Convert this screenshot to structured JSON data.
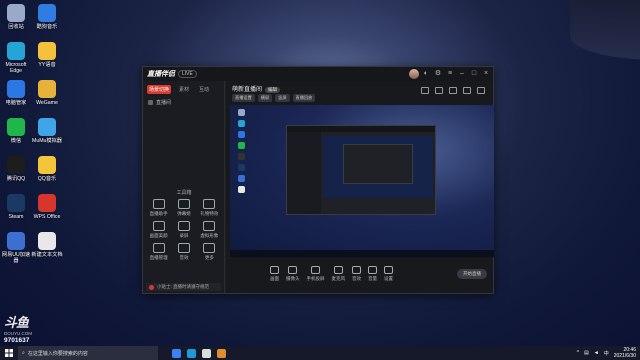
{
  "desktop_icons": [
    {
      "label": "回收站",
      "icon": "recycle-bin-icon",
      "color": "#9aa9c9"
    },
    {
      "label": "酷狗音乐",
      "icon": "kugou-icon",
      "color": "#2f7de1"
    },
    {
      "label": "Microsoft Edge",
      "icon": "edge-icon",
      "color": "#23a6d5"
    },
    {
      "label": "YY语音",
      "icon": "yy-icon",
      "color": "#f3c13a"
    },
    {
      "label": "电脑管家",
      "icon": "pc-manager-icon",
      "color": "#2b78e4"
    },
    {
      "label": "WeGame",
      "icon": "wegame-icon",
      "color": "#e7b23a"
    },
    {
      "label": "微信",
      "icon": "wechat-icon",
      "color": "#1fb74a"
    },
    {
      "label": "MuMu模拟器",
      "icon": "mumu-icon",
      "color": "#3fa4e8"
    },
    {
      "label": "腾讯QQ",
      "icon": "qq-icon",
      "color": "#1d1d1d"
    },
    {
      "label": "QQ音乐",
      "icon": "qqmusic-icon",
      "color": "#f2c53a"
    },
    {
      "label": "Steam",
      "icon": "steam-icon",
      "color": "#1b3a63"
    },
    {
      "label": "WPS Office",
      "icon": "wps-icon",
      "color": "#d6362c"
    },
    {
      "label": "网易UU加速器",
      "icon": "uu-icon",
      "color": "#3b6fd0"
    },
    {
      "label": "新建文本文档",
      "icon": "text-doc-icon",
      "color": "#e8e8e8"
    }
  ],
  "app": {
    "logo": "直播伴侣",
    "logo_badge": "LIVE",
    "tabs": [
      "场景切换",
      "素材",
      "互动"
    ],
    "scene_label": "直播间",
    "room_title": "萌新直播间",
    "room_badge": "编辑",
    "chips": [
      "直播设置",
      "横屏",
      "竖屏",
      "直播回放"
    ],
    "tools_title": "工具箱",
    "tools": [
      "直播助手",
      "弹幕姬",
      "礼物特效",
      "画面美颜",
      "录屏",
      "虚拟形象",
      "直播管理",
      "音效",
      "更多"
    ],
    "left_footer": "小贴士: 直播时请遵守规范",
    "controls": [
      "画面",
      "摄像头",
      "手机投屏",
      "麦克风",
      "音效",
      "音量",
      "设置"
    ],
    "go_live": "开始直播"
  },
  "taskbar": {
    "search_placeholder": "在这里输入你要搜索的内容",
    "time": "20:46",
    "date": "2021/6/30",
    "colors": [
      "#3b82f6",
      "#1e9ad6",
      "#ddd",
      "#e08e2d"
    ]
  },
  "watermark": {
    "logo": "斗鱼",
    "sub": "DOUYU.COM",
    "room_number": "9701637"
  }
}
